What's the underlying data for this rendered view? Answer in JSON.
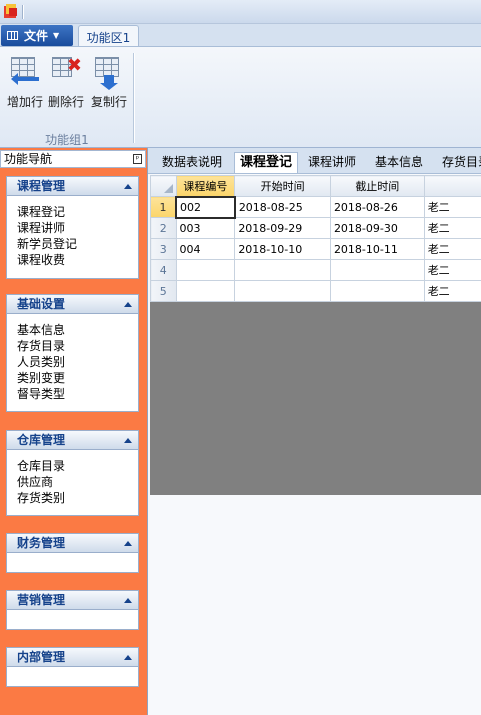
{
  "ribbon": {
    "file_label": "文件",
    "tab_label": "功能区1",
    "buttons": [
      {
        "label": "增加行",
        "icon": "add-row-icon"
      },
      {
        "label": "删除行",
        "icon": "delete-row-icon"
      },
      {
        "label": "复制行",
        "icon": "copy-row-icon"
      }
    ],
    "group_label": "功能组1"
  },
  "nav": {
    "title": "功能导航",
    "groups": [
      {
        "title": "课程管理",
        "items": [
          "课程登记",
          "课程讲师",
          "新学员登记",
          "课程收费"
        ]
      },
      {
        "title": "基础设置",
        "items": [
          "基本信息",
          "存货目录",
          "人员类别",
          "类别变更",
          "督导类型"
        ]
      },
      {
        "title": "仓库管理",
        "items": [
          "仓库目录",
          "供应商",
          "存货类别"
        ]
      },
      {
        "title": "财务管理",
        "items": []
      },
      {
        "title": "营销管理",
        "items": []
      },
      {
        "title": "内部管理",
        "items": []
      }
    ]
  },
  "doc_tabs": [
    "数据表说明",
    "课程登记",
    "课程讲师",
    "基本信息",
    "存货目录"
  ],
  "active_doc_tab": "课程登记",
  "table": {
    "columns": [
      "课程编号",
      "开始时间",
      "截止时间",
      ""
    ],
    "rows": [
      {
        "num": "1",
        "cells": [
          "002",
          "2018-08-25",
          "2018-08-26",
          "老二"
        ]
      },
      {
        "num": "2",
        "cells": [
          "003",
          "2018-09-29",
          "2018-09-30",
          "老二"
        ]
      },
      {
        "num": "3",
        "cells": [
          "004",
          "2018-10-10",
          "2018-10-11",
          "老二"
        ]
      },
      {
        "num": "4",
        "cells": [
          "",
          "",
          "",
          "老二"
        ]
      },
      {
        "num": "5",
        "cells": [
          "",
          "",
          "",
          "老二"
        ]
      }
    ]
  },
  "colors": {
    "nav_background": "#fb7a44",
    "accent": "#15428b",
    "selection": "#fbd56a"
  }
}
